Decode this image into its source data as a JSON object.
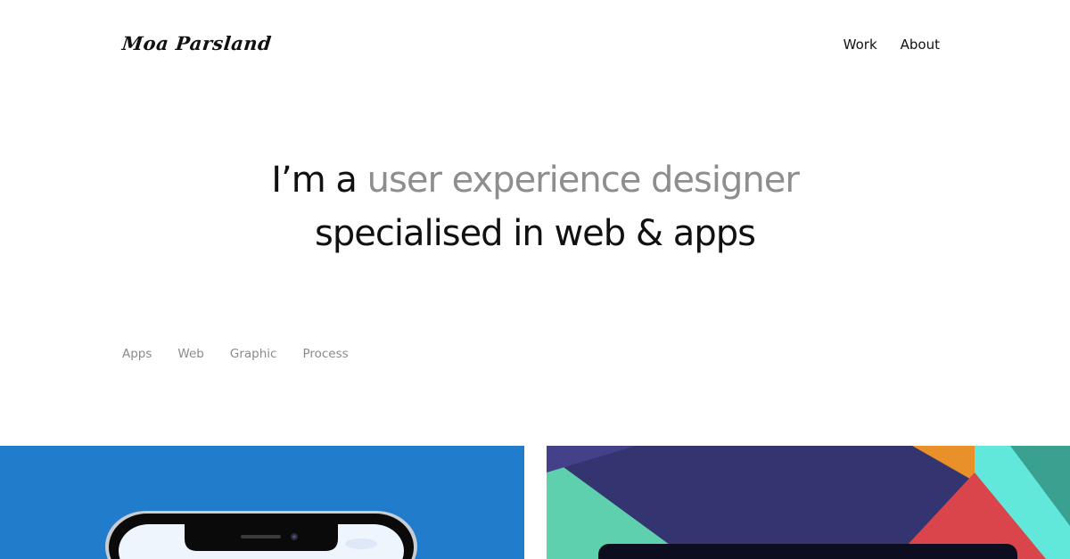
{
  "header": {
    "logo": "Moa Parsland",
    "nav": [
      {
        "label": "Work"
      },
      {
        "label": "About"
      }
    ]
  },
  "hero": {
    "line1_prefix": "I’m a ",
    "line1_highlight": "user experience designer",
    "line2": "specialised in web & apps"
  },
  "filters": [
    {
      "label": "Apps"
    },
    {
      "label": "Web"
    },
    {
      "label": "Graphic"
    },
    {
      "label": "Process"
    }
  ],
  "colors": {
    "text": "#111111",
    "muted": "#8e8e8e",
    "card_blue": "#1f78c8",
    "card_navy": "#343470",
    "card_teal": "#5fd0ae",
    "card_cyan": "#62e8da",
    "card_orange": "#e8902a",
    "card_red": "#d9454b"
  },
  "projects": [
    {
      "name": "phone-app-project",
      "icon": "smartphone-illustration"
    },
    {
      "name": "geometric-project",
      "icon": "geometric-illustration"
    }
  ]
}
